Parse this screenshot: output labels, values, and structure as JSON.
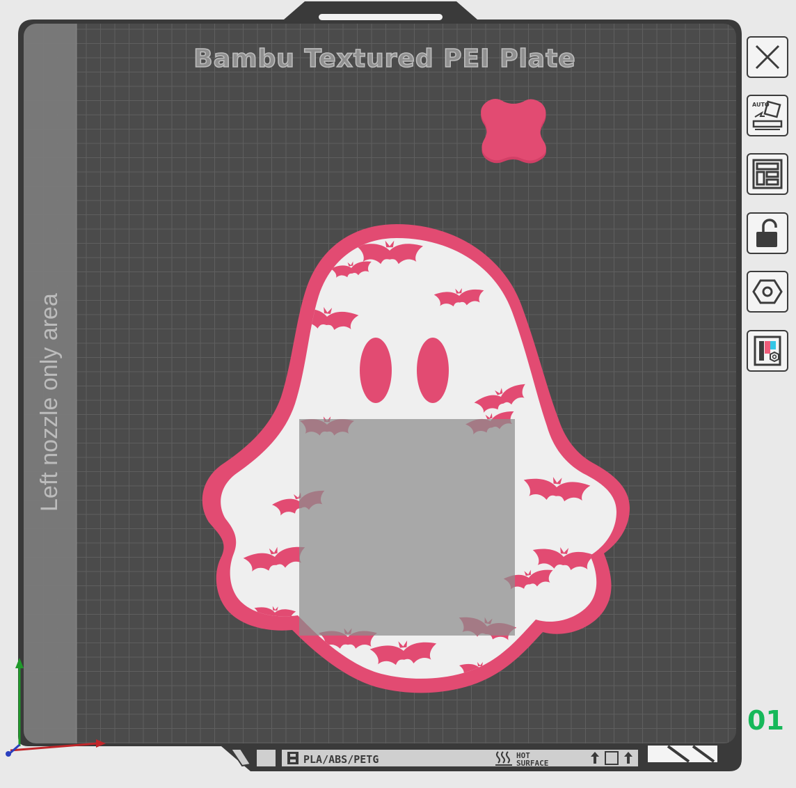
{
  "plate": {
    "title": "Bambu Textured PEI Plate",
    "left_nozzle_label": "Left nozzle only area",
    "plate_number": "01",
    "filament_label": "PLA/ABS/PETG",
    "hot_label_line1": "HOT",
    "hot_label_line2": "SURFACE"
  },
  "toolbar": {
    "items": [
      {
        "name": "close-button",
        "icon": "close-icon"
      },
      {
        "name": "auto-orient-button",
        "icon": "auto-orient-icon",
        "badge": "AUTO"
      },
      {
        "name": "arrange-button",
        "icon": "arrange-icon"
      },
      {
        "name": "lock-button",
        "icon": "unlock-icon"
      },
      {
        "name": "plate-settings-button",
        "icon": "hex-nut-icon"
      },
      {
        "name": "filament-settings-button",
        "icon": "filament-settings-icon"
      }
    ]
  },
  "colors": {
    "plate": "#4b4b4b",
    "grid": "#5e5e5e",
    "model_pink": "#e24b72",
    "model_white": "#efefef",
    "left_area": "#777777",
    "plate_number": "#17b85a"
  }
}
